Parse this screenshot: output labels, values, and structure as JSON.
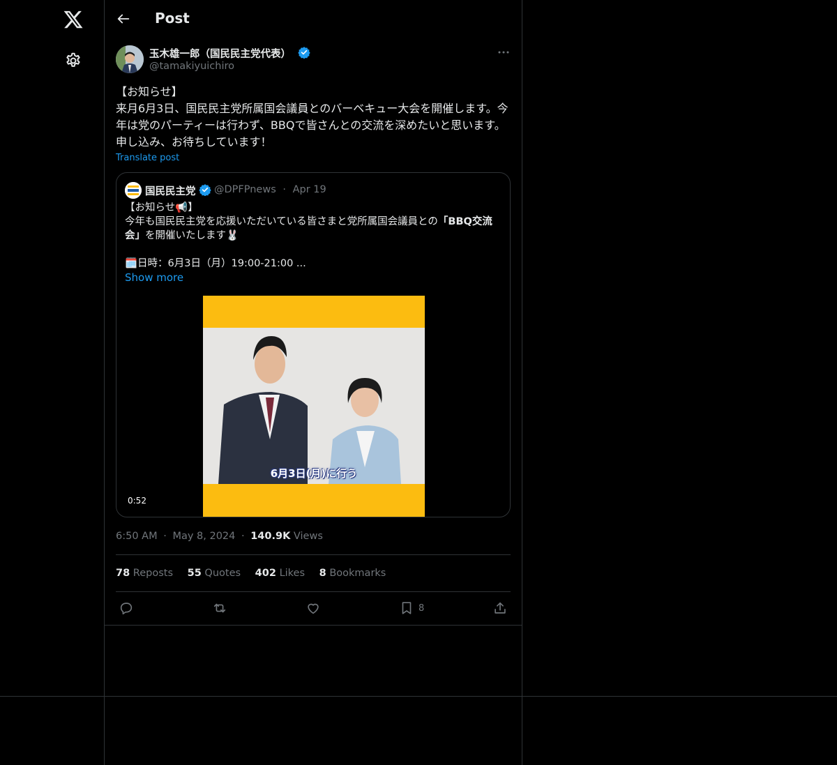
{
  "header": {
    "title": "Post"
  },
  "author": {
    "name": "玉木雄一郎（国民民主党代表）",
    "handle": "@tamakiyuichiro"
  },
  "post": {
    "text": "【お知らせ】\n来月6月3日、国民民主党所属国会議員とのバーベキュー大会を開催します。今年は党のパーティーは行わず、BBQで皆さんとの交流を深めたいと思います。申し込み、お待ちしています！",
    "translate_label": "Translate post"
  },
  "quote": {
    "name": "国民民主党",
    "handle": "@DPFPnews",
    "separator": "·",
    "date": "Apr 19",
    "lines": {
      "l1": "【お知らせ📢】",
      "l2_a": "今年も国民民主党を応援いただいている皆さまと党所属国会議員との",
      "l2_b": "「BBQ交流会」",
      "l3": "を開催いたします🐰",
      "l4": "🗓️日時：6月3日（月）19:00-21:00 ..."
    },
    "show_more": "Show more",
    "media": {
      "caption": "6月3日(月)に行う",
      "duration": "0:52"
    }
  },
  "meta": {
    "time": "6:50 AM",
    "dot1": "·",
    "date": "May 8, 2024",
    "dot2": "·",
    "views_count": "140.9K",
    "views_label": "Views"
  },
  "stats": {
    "reposts_count": "78",
    "reposts_label": "Reposts",
    "quotes_count": "55",
    "quotes_label": "Quotes",
    "likes_count": "402",
    "likes_label": "Likes",
    "bookmarks_count": "8",
    "bookmarks_label": "Bookmarks"
  },
  "actions": {
    "bookmark_count": "8"
  },
  "colors": {
    "background": "#000000",
    "text": "#e7e9ea",
    "muted": "#71767b",
    "accent": "#1d9bf0",
    "border": "#2f3336",
    "video_frame": "#fcbc10"
  },
  "icons": [
    "x-logo-icon",
    "gear-icon",
    "back-arrow-icon",
    "verified-badge-icon",
    "more-icon",
    "reply-icon",
    "repost-icon",
    "like-icon",
    "bookmark-icon",
    "share-icon"
  ]
}
